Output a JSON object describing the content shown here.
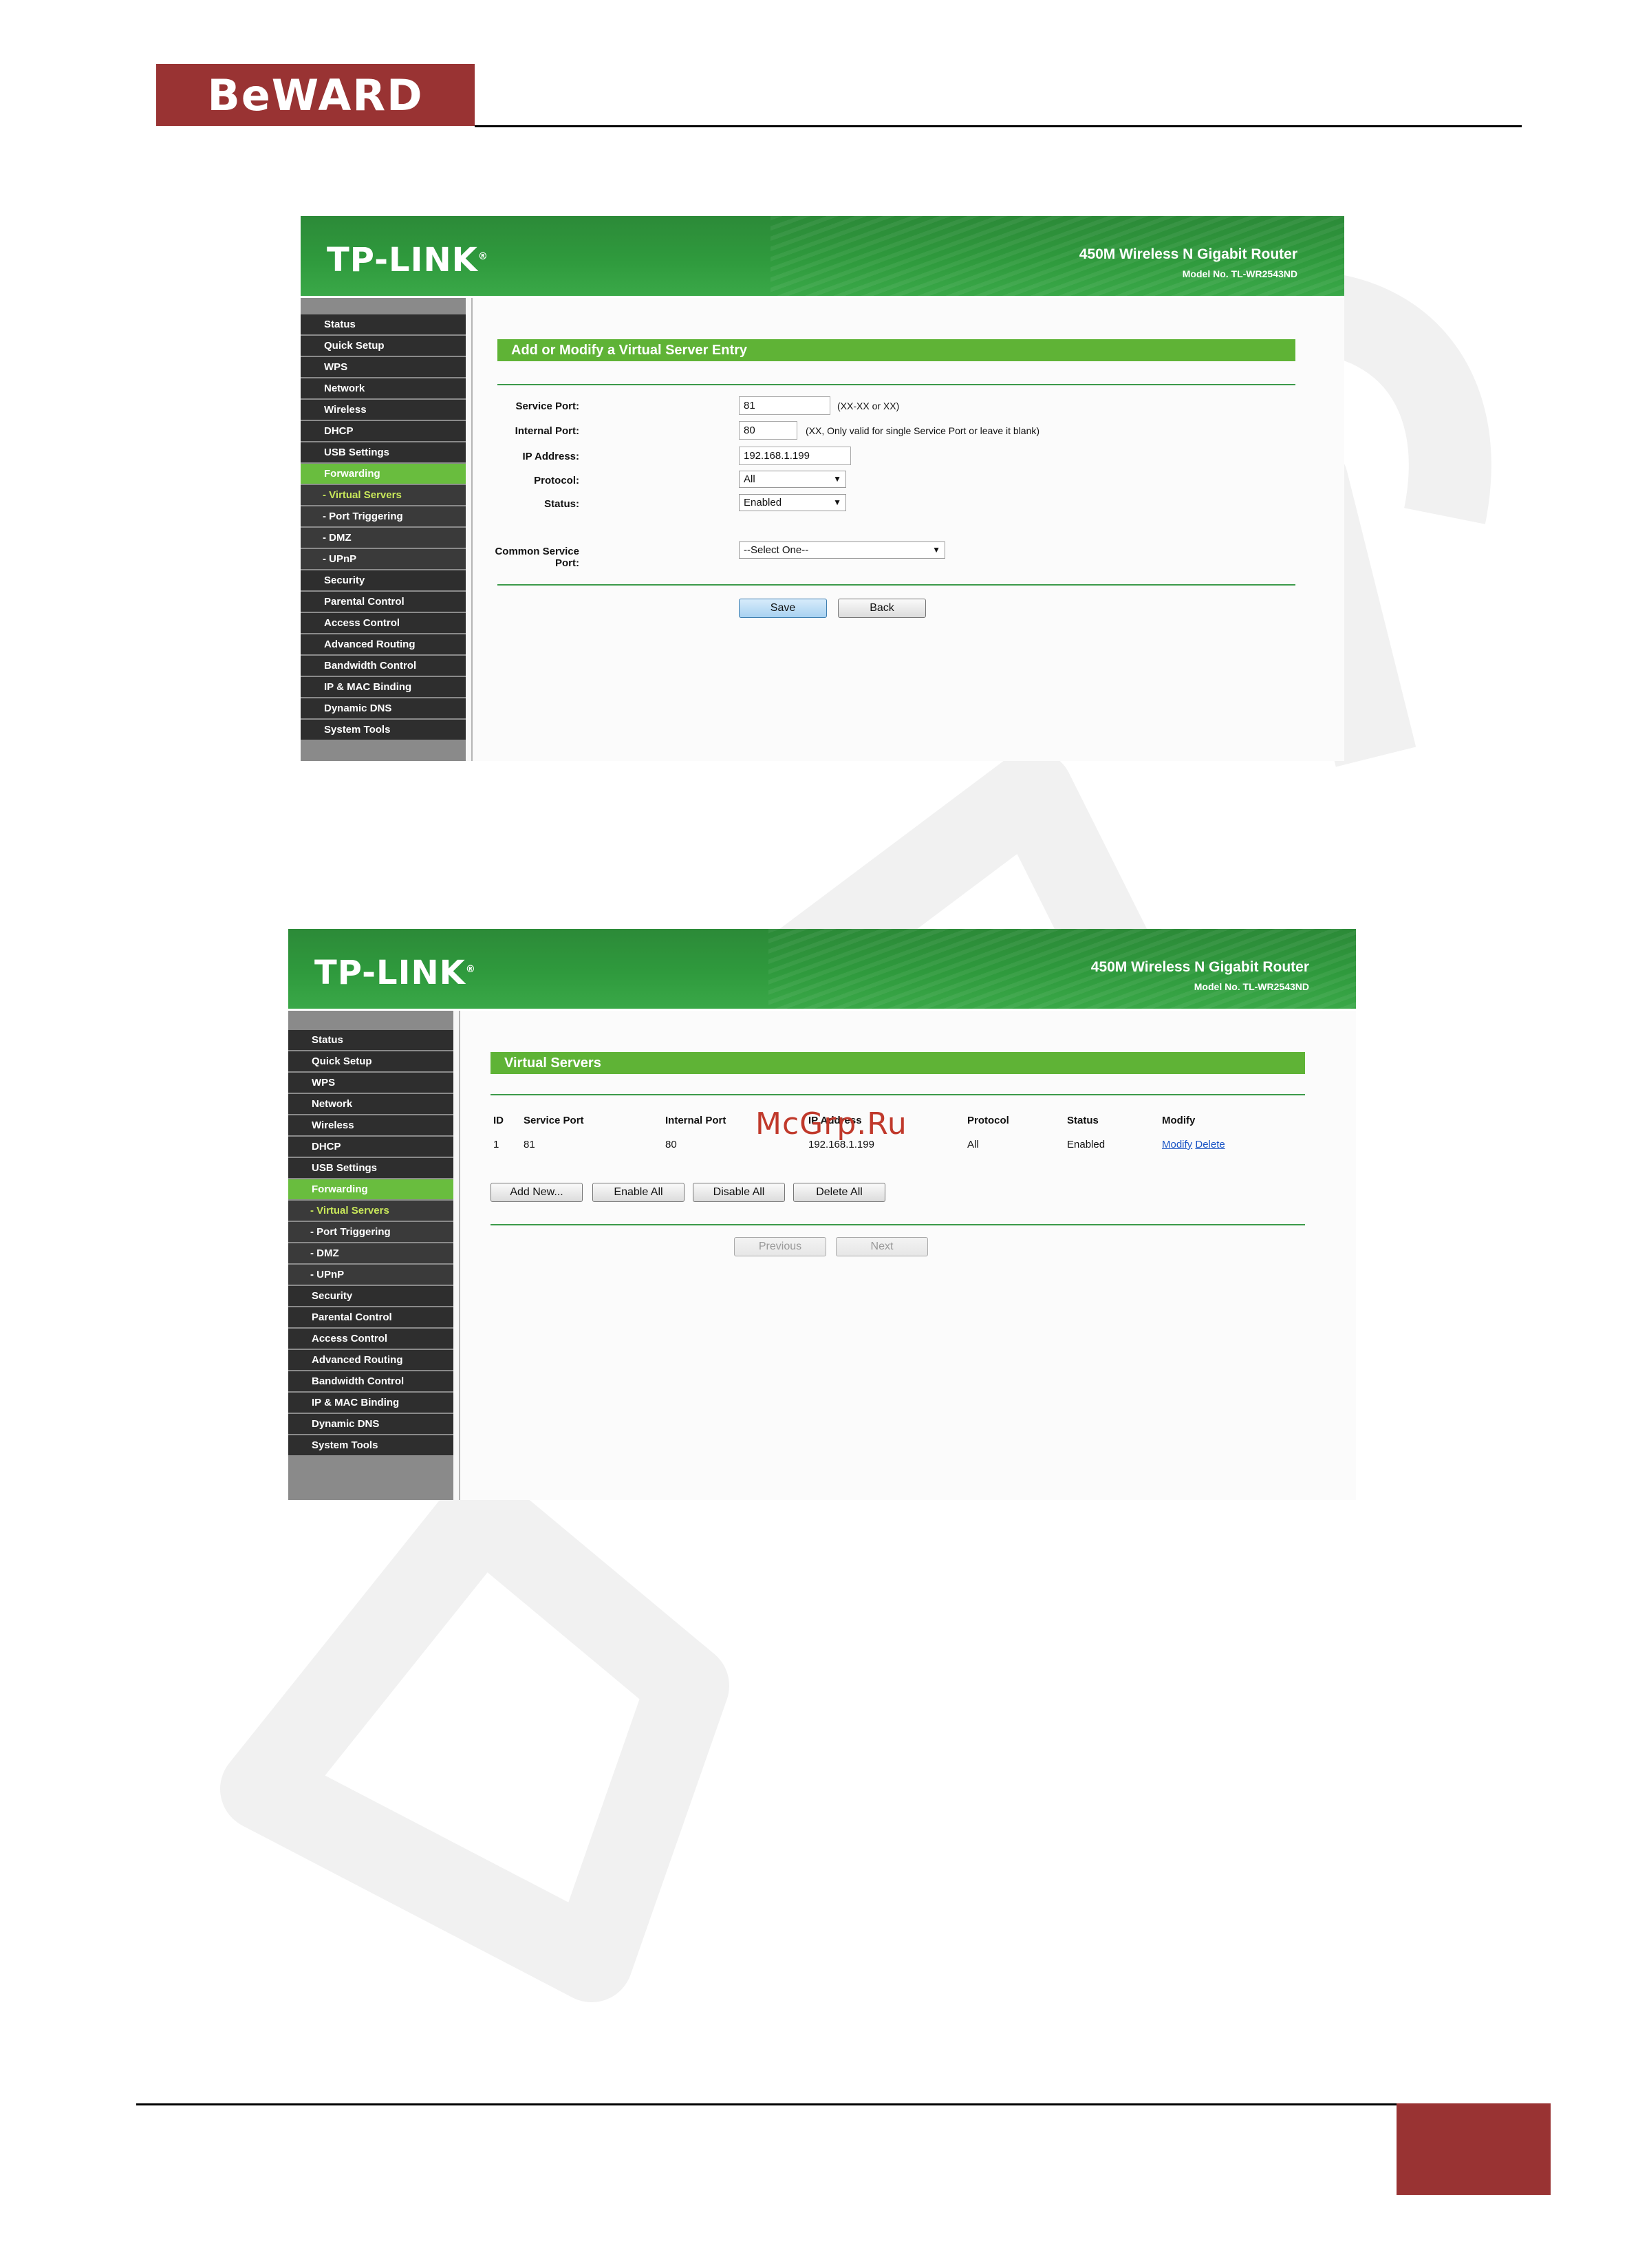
{
  "page": {
    "logo": "BeWARD",
    "watermark_site": "McGrp.Ru"
  },
  "router": {
    "brand": "TP-LINK",
    "product": "450M Wireless N Gigabit Router",
    "model": "Model No. TL-WR2543ND"
  },
  "menu": [
    "Status",
    "Quick Setup",
    "WPS",
    "Network",
    "Wireless",
    "DHCP",
    "USB Settings",
    "Forwarding",
    "- Virtual Servers",
    "- Port Triggering",
    "- DMZ",
    "- UPnP",
    "Security",
    "Parental Control",
    "Access Control",
    "Advanced Routing",
    "Bandwidth Control",
    "IP & MAC Binding",
    "Dynamic DNS",
    "System Tools"
  ],
  "form": {
    "title": "Add or Modify a Virtual Server Entry",
    "service_port_label": "Service Port:",
    "service_port_value": "81",
    "service_port_hint": "(XX-XX or XX)",
    "internal_port_label": "Internal Port:",
    "internal_port_value": "80",
    "internal_port_hint": "(XX, Only valid for single Service Port or leave it blank)",
    "ip_label": "IP Address:",
    "ip_value": "192.168.1.199",
    "protocol_label": "Protocol:",
    "protocol_value": "All",
    "status_label": "Status:",
    "status_value": "Enabled",
    "common_label": "Common Service Port:",
    "common_value": "--Select One--",
    "save": "Save",
    "back": "Back"
  },
  "list": {
    "title": "Virtual Servers",
    "headers": {
      "id": "ID",
      "service_port": "Service Port",
      "internal_port": "Internal Port",
      "ip": "IP Address",
      "protocol": "Protocol",
      "status": "Status",
      "modify": "Modify"
    },
    "row": {
      "id": "1",
      "service_port": "81",
      "internal_port": "80",
      "ip": "192.168.1.199",
      "protocol": "All",
      "status": "Enabled",
      "modify": "Modify",
      "delete": "Delete"
    },
    "add_new": "Add New...",
    "enable_all": "Enable All",
    "disable_all": "Disable All",
    "delete_all": "Delete All",
    "previous": "Previous",
    "next": "Next"
  },
  "colors": {
    "brand_red": "#993333",
    "banner_green": "#2f9a3d",
    "menu_active": "#69bd3e"
  }
}
